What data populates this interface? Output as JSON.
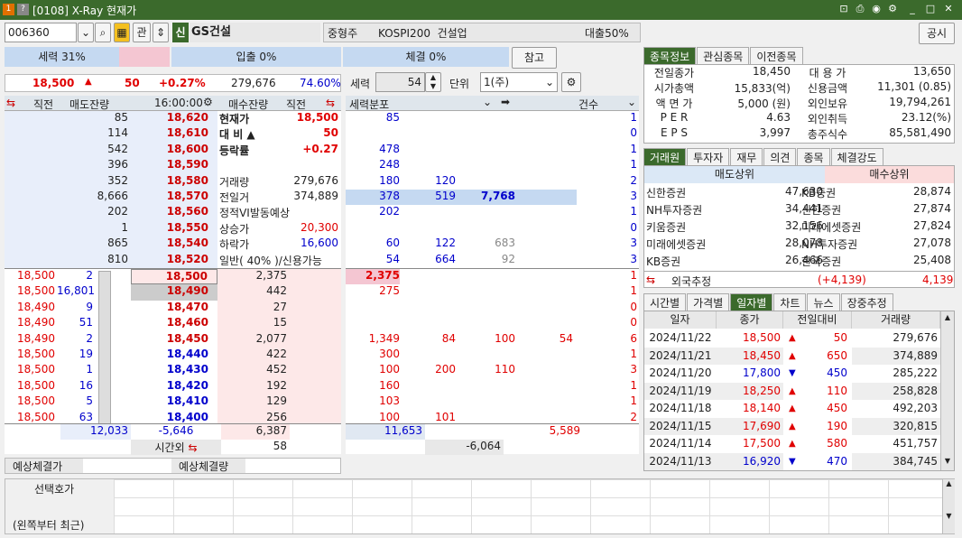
{
  "window": {
    "icon1": "1",
    "icon2": "?",
    "title": "[0108] X-Ray 현재가"
  },
  "toolbar": {
    "code": "006360",
    "fav": "관",
    "badge": "신",
    "name": "GS건설",
    "info": "중형주      KOSPI200  건설업",
    "loan": "대출50%",
    "notice": "공시",
    "ref": "참고"
  },
  "strength": {
    "label": "세력 31%",
    "inflow": "입출 0%",
    "exec": "체결 0%"
  },
  "summary": {
    "price": "18,500",
    "arrow": "▲",
    "change": "50",
    "pct": "+0.27%",
    "volume": "279,676",
    "ratio": "74.60%"
  },
  "controls": {
    "seryok_label": "세력",
    "seryok_val": "54",
    "unit_label": "단위",
    "unit_val": "1(주)"
  },
  "ob_header": {
    "c1": "직전",
    "c2": "매도잔량",
    "time": "16:00:00",
    "c4": "매수잔량",
    "c5": "직전",
    "dist": "세력분포",
    "cnt": "건수"
  },
  "asks": [
    {
      "qty": "85",
      "price": "18,620",
      "k": "현재가",
      "v": "18,500",
      "d": "85",
      "cnt": "1"
    },
    {
      "qty": "114",
      "price": "18,610",
      "k": "대  비  ▲",
      "v": "50",
      "d": "",
      "cnt": "0"
    },
    {
      "qty": "542",
      "price": "18,600",
      "k": "등락률",
      "v": "+0.27",
      "d": "478",
      "cnt": "1"
    },
    {
      "qty": "396",
      "price": "18,590",
      "k": "",
      "v": "",
      "d": "248",
      "cnt": "1"
    },
    {
      "qty": "352",
      "price": "18,580",
      "k": "거래량",
      "v": "279,676",
      "d": "180",
      "d2": "120",
      "cnt": "2"
    },
    {
      "qty": "8,666",
      "price": "18,570",
      "k": "전일거",
      "v": "374,889",
      "d": "378",
      "d2": "519",
      "d3": "7,768",
      "cnt": "3"
    },
    {
      "qty": "202",
      "price": "18,560",
      "k": "정적VI발동예상",
      "v": "",
      "d": "202",
      "cnt": "1"
    },
    {
      "qty": "1",
      "price": "18,550",
      "k": "상승가",
      "v": "20,300",
      "d": "",
      "cnt": "0"
    },
    {
      "qty": "865",
      "price": "18,540",
      "k": "하락가",
      "v": "16,600",
      "d": "60",
      "d2": "122",
      "d3": "683",
      "cnt": "3"
    },
    {
      "qty": "810",
      "price": "18,520",
      "k": "일반( 40% )/신용가능",
      "v": "",
      "d": "54",
      "d2": "664",
      "d3": "92",
      "cnt": "3"
    }
  ],
  "bids": [
    {
      "prev": "18,500",
      "pq": "2",
      "price": "18,500",
      "qty": "2,375",
      "d": "2,375",
      "cnt": "1"
    },
    {
      "prev": "18,500",
      "pq": "16,801",
      "price": "18,490",
      "qty": "442",
      "d": "275",
      "cnt": "1"
    },
    {
      "prev": "18,490",
      "pq": "9",
      "price": "18,470",
      "qty": "27",
      "d": "",
      "cnt": "0"
    },
    {
      "prev": "18,490",
      "pq": "51",
      "price": "18,460",
      "qty": "15",
      "d": "",
      "cnt": "0"
    },
    {
      "prev": "18,490",
      "pq": "2",
      "price": "18,450",
      "qty": "2,077",
      "d": "1,349",
      "d2": "84",
      "d3": "100",
      "d4": "54",
      "cnt": "6"
    },
    {
      "prev": "18,500",
      "pq": "19",
      "price": "18,440",
      "qty": "422",
      "d": "300",
      "cnt": "1"
    },
    {
      "prev": "18,500",
      "pq": "1",
      "price": "18,430",
      "qty": "452",
      "d": "100",
      "d2": "200",
      "d3": "110",
      "cnt": "3"
    },
    {
      "prev": "18,500",
      "pq": "16",
      "price": "18,420",
      "qty": "192",
      "d": "160",
      "cnt": "1"
    },
    {
      "prev": "18,500",
      "pq": "5",
      "price": "18,410",
      "qty": "129",
      "d": "103",
      "cnt": "1"
    },
    {
      "prev": "18,500",
      "pq": "63",
      "price": "18,400",
      "qty": "256",
      "d": "100",
      "d2": "101",
      "cnt": "2"
    }
  ],
  "totals": {
    "ask_total": "12,033",
    "diff": "-5,646",
    "bid_total": "6,387",
    "after": "시간외",
    "after_val": "58",
    "dist_ask": "11,653",
    "dist_bid": "5,589",
    "dist_diff": "-6,064"
  },
  "expect": {
    "l1": "예상체결가",
    "l2": "예상체결량"
  },
  "bottom": {
    "l1": "선택호가",
    "l2": "(왼쪽부터 최근)"
  },
  "tabs1": [
    "종목정보",
    "관심종목",
    "이전종목"
  ],
  "info": [
    [
      "전일종가",
      "18,450",
      "대 용 가",
      "13,650"
    ],
    [
      "시가총액",
      "15,833(억)",
      "신용금액",
      "11,301  (0.85)"
    ],
    [
      "액 면 가",
      "5,000 (원)",
      "외인보유",
      "19,794,261"
    ],
    [
      "P E R",
      "4.63",
      "외인취득",
      "23.12(%)"
    ],
    [
      "E P S",
      "3,997",
      "총주식수",
      "85,581,490"
    ]
  ],
  "tabs2": [
    "거래원",
    "투자자",
    "재무",
    "의견",
    "종목",
    "체결강도"
  ],
  "broker": {
    "sell": "매도상위",
    "buy": "매수상위",
    "rows": [
      [
        "신한증권",
        "47,630",
        "KB증권",
        "28,874"
      ],
      [
        "NH투자증권",
        "34,441",
        "신한증권",
        "27,874"
      ],
      [
        "키움증권",
        "32,156",
        "미래에셋증권",
        "27,824"
      ],
      [
        "미래에셋증권",
        "28,078",
        "NH투자증권",
        "27,078"
      ],
      [
        "KB증권",
        "26,466",
        "한국증권",
        "25,408"
      ]
    ],
    "foreign": "외국추정",
    "f1": "(+4,139)",
    "f2": "4,139"
  },
  "tabs3": [
    "시간별",
    "가격별",
    "일자별",
    "차트",
    "뉴스",
    "장중추정"
  ],
  "daily": {
    "headers": [
      "일자",
      "종가",
      "전일대비",
      "거래량"
    ],
    "rows": [
      [
        "2024/11/22",
        "18,500",
        "▲",
        "50",
        "279,676"
      ],
      [
        "2024/11/21",
        "18,450",
        "▲",
        "650",
        "374,889"
      ],
      [
        "2024/11/20",
        "17,800",
        "▼",
        "450",
        "285,222"
      ],
      [
        "2024/11/19",
        "18,250",
        "▲",
        "110",
        "258,828"
      ],
      [
        "2024/11/18",
        "18,140",
        "▲",
        "450",
        "492,203"
      ],
      [
        "2024/11/15",
        "17,690",
        "▲",
        "190",
        "320,815"
      ],
      [
        "2024/11/14",
        "17,500",
        "▲",
        "580",
        "451,757"
      ],
      [
        "2024/11/13",
        "16,920",
        "▼",
        "470",
        "384,745"
      ]
    ]
  }
}
